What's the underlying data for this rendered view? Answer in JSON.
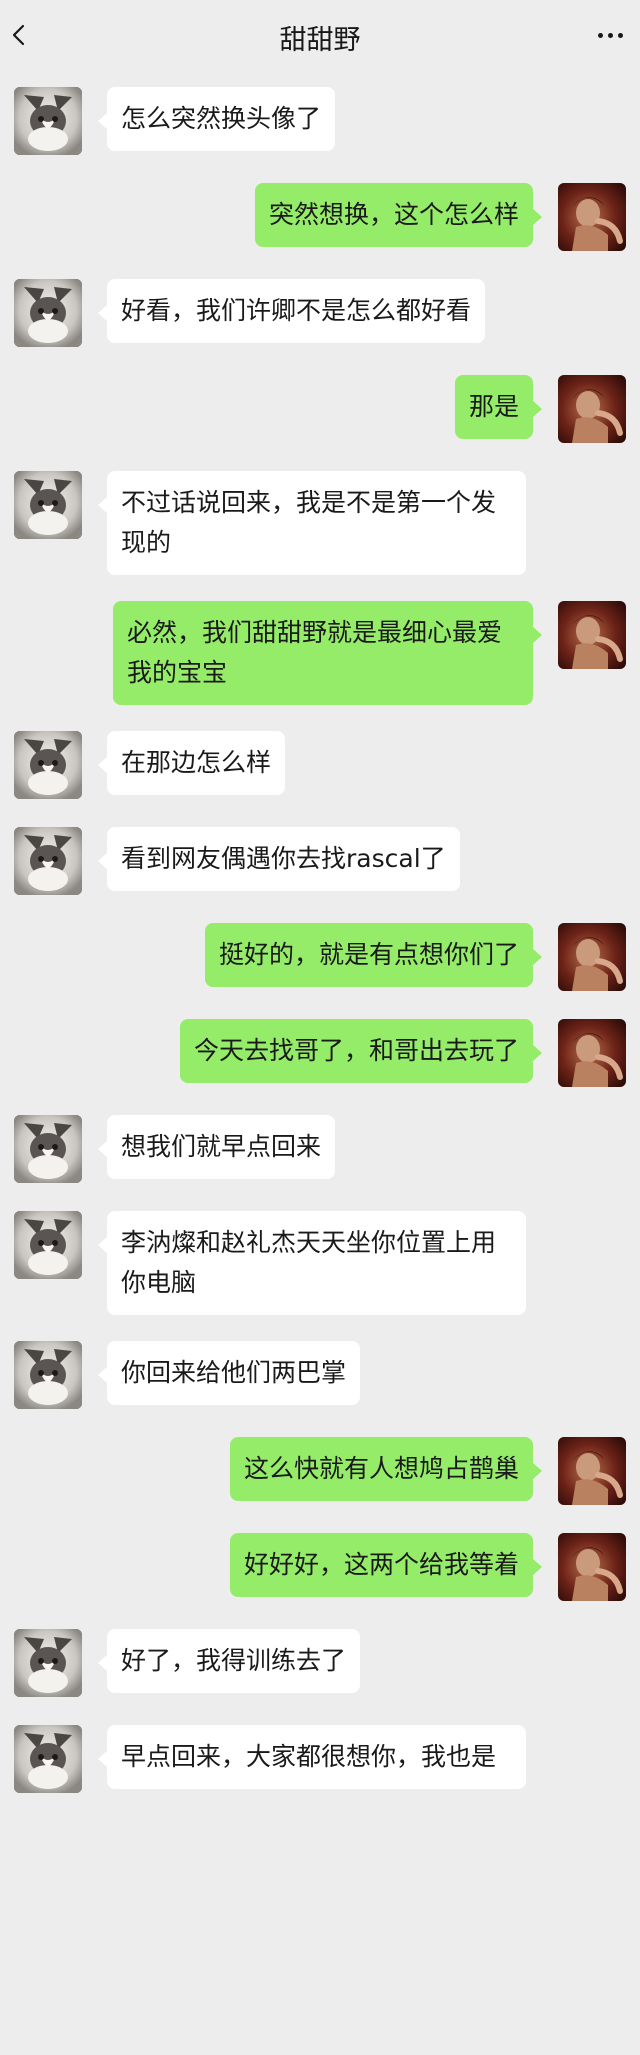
{
  "header": {
    "title": "甜甜野",
    "back_icon": "chevron-left-icon",
    "more_icon": "more-dots-icon"
  },
  "contact_avatar": "cat-avatar",
  "self_avatar": "portrait-avatar",
  "messages": [
    {
      "side": "left",
      "text": "怎么突然换头像了"
    },
    {
      "side": "right",
      "text": "突然想换，这个怎么样"
    },
    {
      "side": "left",
      "text": "好看，我们许卿不是怎么都好看"
    },
    {
      "side": "right",
      "text": "那是"
    },
    {
      "side": "left",
      "text": "不过话说回来，我是不是第一个发现的"
    },
    {
      "side": "right",
      "text": "必然，我们甜甜野就是最细心最爱我的宝宝"
    },
    {
      "side": "left",
      "text": "在那边怎么样"
    },
    {
      "side": "left",
      "text": "看到网友偶遇你去找rascal了"
    },
    {
      "side": "right",
      "text": "挺好的，就是有点想你们了"
    },
    {
      "side": "right",
      "text": "今天去找哥了，和哥出去玩了"
    },
    {
      "side": "left",
      "text": "想我们就早点回来"
    },
    {
      "side": "left",
      "text": "李汭燦和赵礼杰天天坐你位置上用你电脑"
    },
    {
      "side": "left",
      "text": "你回来给他们两巴掌"
    },
    {
      "side": "right",
      "text": "这么快就有人想鸠占鹊巢"
    },
    {
      "side": "right",
      "text": "好好好，这两个给我等着"
    },
    {
      "side": "left",
      "text": "好了，我得训练去了"
    },
    {
      "side": "left",
      "text": "早点回来，大家都很想你，我也是"
    }
  ],
  "colors": {
    "background": "#ededed",
    "bubble_self": "#95ec69",
    "bubble_other": "#ffffff"
  }
}
